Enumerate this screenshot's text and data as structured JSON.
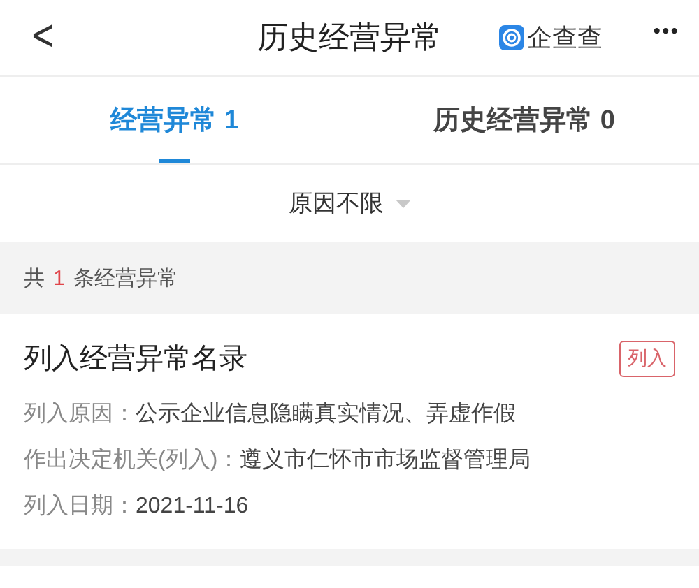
{
  "header": {
    "back": "<",
    "title": "历史经营异常",
    "brand": "企查查",
    "more": "•••"
  },
  "tabs": [
    {
      "label": "经营异常 1",
      "selected": true
    },
    {
      "label": "历史经营异常 0",
      "selected": false
    }
  ],
  "filter": {
    "label": "原因不限"
  },
  "summary": {
    "prefix": "共",
    "count": "1",
    "suffix": "条经营异常"
  },
  "records": [
    {
      "title": "列入经营异常名录",
      "tag": "列入",
      "fields": [
        {
          "label": "列入原因：",
          "value": "公示企业信息隐瞒真实情况、弄虚作假"
        },
        {
          "label": "作出决定机关(列入)：",
          "value": "遵义市仁怀市市场监督管理局"
        },
        {
          "label": "列入日期：",
          "value": "2021-11-16"
        }
      ]
    }
  ]
}
